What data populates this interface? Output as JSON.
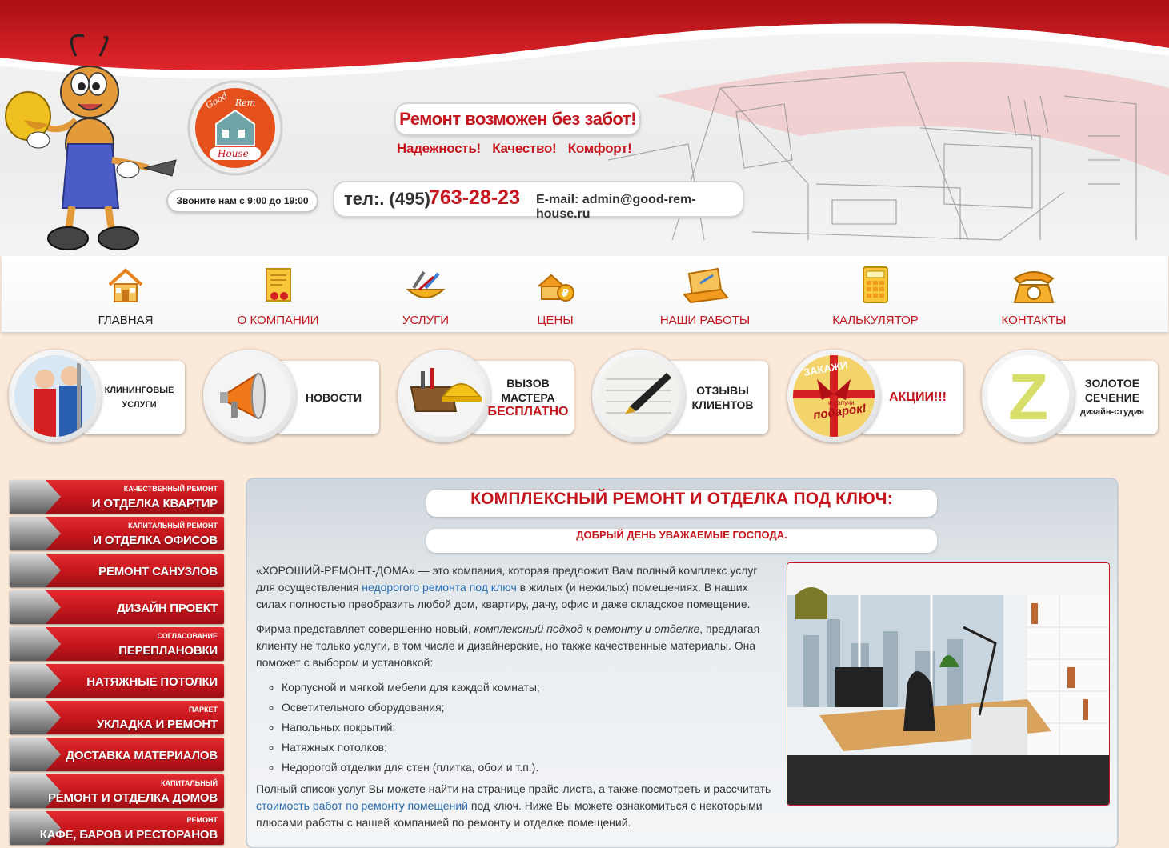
{
  "header": {
    "slogan": "Ремонт возможен без забот!",
    "qualities": [
      "Надежность!",
      "Качество!",
      "Комфорт!"
    ],
    "hours": "Звоните нам с 9:00 до 19:00",
    "tel_label": "тел:. (495)",
    "tel_number": "763-28-23",
    "email": "E-mail: admin@good-rem-house.ru",
    "logo": {
      "line1": "Good",
      "line2": "Rem",
      "line3": "House"
    }
  },
  "nav": [
    {
      "label": "ГЛАВНАЯ",
      "icon": "home-icon",
      "active": true
    },
    {
      "label": "О КОМПАНИИ",
      "icon": "certificate-icon"
    },
    {
      "label": "УСЛУГИ",
      "icon": "tools-icon"
    },
    {
      "label": "ЦЕНЫ",
      "icon": "house-ruble-icon"
    },
    {
      "label": "НАШИ РАБОТЫ",
      "icon": "laptop-icon"
    },
    {
      "label": "КАЛЬКУЛЯТОР",
      "icon": "calculator-icon"
    },
    {
      "label": "КОНТАКТЫ",
      "icon": "phone-icon"
    }
  ],
  "promos": [
    {
      "lines": [
        "КЛИНИНГОВЫЕ",
        "УСЛУГИ"
      ]
    },
    {
      "lines": [
        "НОВОСТИ"
      ]
    },
    {
      "lines": [
        "ВЫЗОВ",
        "МАСТЕРА"
      ],
      "highlight": "БЕСПЛАТНО"
    },
    {
      "lines": [
        "ОТЗЫВЫ",
        "КЛИЕНТОВ"
      ]
    },
    {
      "highlight": "АКЦИИ!!!",
      "badge_top": "ЗАКАЖИ",
      "badge_mid": "и получи",
      "badge_bottom": "подарок!"
    },
    {
      "lines": [
        "ЗОЛОТОЕ",
        "СЕЧЕНИЕ"
      ],
      "small": "дизайн-студия",
      "badge": "Z"
    }
  ],
  "sidebar": [
    {
      "top": "Качественный ремонт",
      "main": "И ОТДЕЛКА КВАРТИР"
    },
    {
      "top": "Капитальный ремонт",
      "main": "И ОТДЕЛКА ОФИСОВ"
    },
    {
      "main": "РЕМОНТ САНУЗЛОВ"
    },
    {
      "main": "ДИЗАЙН ПРОЕКТ"
    },
    {
      "top": "Согласование",
      "main": "ПЕРЕПЛАНОВКИ"
    },
    {
      "main": "НАТЯЖНЫЕ ПОТОЛКИ"
    },
    {
      "top": "Паркет",
      "main": "УКЛАДКА И РЕМОНТ"
    },
    {
      "main": "ДОСТАВКА МАТЕРИАЛОВ"
    },
    {
      "top": "Капитальный",
      "main": "РЕМОНТ И ОТДЕЛКА ДОМОВ"
    },
    {
      "top": "Ремонт",
      "main": "КАФЕ, БАРОВ И РЕСТОРАНОВ"
    }
  ],
  "main": {
    "title": "КОМПЛЕКСНЫЙ РЕМОНТ И ОТДЕЛКА ПОД КЛЮЧ:",
    "subtitle": "ДОБРЫЙ ДЕНЬ УВАЖАЕМЫЕ ГОСПОДА.",
    "p1_a": "«ХОРОШИЙ-РЕМОНТ-ДОМА» — это компания, которая предложит Вам полный комплекс услуг для осуществления ",
    "p1_link": "недорогого ремонта под ключ",
    "p1_b": " в жилых (и нежилых) помещениях. В наших силах полностью преобразить любой дом, квартиру, дачу, офис и даже складское помещение.",
    "p2_a": "Фирма представляет совершенно новый, ",
    "p2_em": "комплексный подход к ремонту и отделке",
    "p2_b": ", предлагая клиенту не только услуги, в том числе и дизайнерские, но также качественные материалы. Она поможет с выбором и установкой:",
    "list": [
      "Корпусной и мягкой мебели для каждой комнаты;",
      "Осветительного оборудования;",
      "Напольных покрытий;",
      "Натяжных потолков;",
      "Недорогой отделки для стен (плитка, обои и т.п.)."
    ],
    "p3_a": "Полный список услуг Вы можете найти на странице прайс-листа, а также посмотреть и рассчитать ",
    "p3_link": "стоимость работ по ремонту помещений",
    "p3_b": " под ключ. Ниже Вы можете ознакомиться с некоторыми плюсами работы с нашей компанией по ремонту и отделке помещений."
  }
}
